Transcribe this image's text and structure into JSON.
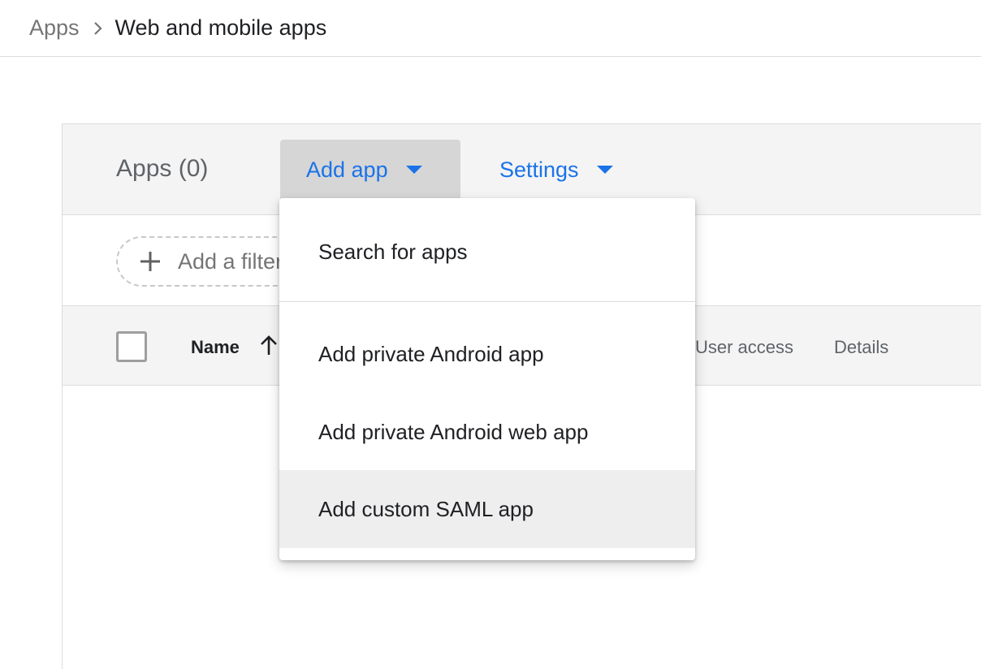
{
  "breadcrumb": {
    "parent": "Apps",
    "current": "Web and mobile apps"
  },
  "header": {
    "apps_count": "Apps (0)",
    "add_app_label": "Add app",
    "settings_label": "Settings"
  },
  "filter": {
    "placeholder": "Add a filter"
  },
  "table": {
    "columns": {
      "name": "Name",
      "user_access": "User access",
      "details": "Details"
    }
  },
  "menu": {
    "items": [
      "Search for apps",
      "Add private Android app",
      "Add private Android web app",
      "Add custom SAML app"
    ]
  },
  "colors": {
    "accent": "#1a73e8",
    "header_bg": "#f4f4f4",
    "button_active_bg": "#d6d6d6",
    "menu_hover_bg": "#eeeeee"
  },
  "icons": {
    "breadcrumb_separator": "chevron-right-icon",
    "dropdown": "caret-down-icon",
    "filter": "plus-icon",
    "sort": "arrow-up-icon"
  }
}
